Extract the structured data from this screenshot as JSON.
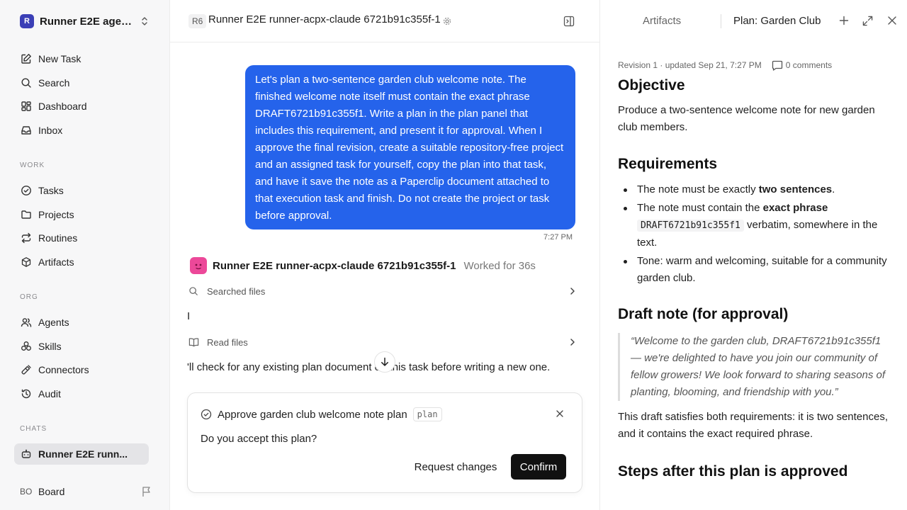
{
  "sidebar": {
    "workspace": {
      "logo": "R",
      "name": "Runner E2E agen..."
    },
    "top_items": [
      {
        "label": "New Task",
        "icon": "edit-icon"
      },
      {
        "label": "Search",
        "icon": "search-icon"
      },
      {
        "label": "Dashboard",
        "icon": "dashboard-icon"
      },
      {
        "label": "Inbox",
        "icon": "inbox-icon"
      }
    ],
    "work_label": "WORK",
    "work_items": [
      {
        "label": "Tasks",
        "icon": "check-circle-icon"
      },
      {
        "label": "Projects",
        "icon": "folder-icon"
      },
      {
        "label": "Routines",
        "icon": "repeat-icon"
      },
      {
        "label": "Artifacts",
        "icon": "cube-icon"
      }
    ],
    "org_label": "ORG",
    "org_items": [
      {
        "label": "Agents",
        "icon": "users-icon"
      },
      {
        "label": "Skills",
        "icon": "skills-icon"
      },
      {
        "label": "Connectors",
        "icon": "plug-icon"
      },
      {
        "label": "Audit",
        "icon": "history-icon"
      }
    ],
    "chats_label": "CHATS",
    "chat_item": "Runner E2E runn...",
    "user": {
      "initials": "BO",
      "name": "Board"
    }
  },
  "topbar": {
    "badge": "R6",
    "title": "Runner E2E runner-acpx-claude 6721b91c355f-1"
  },
  "chat": {
    "user_message": "Let's plan a two-sentence garden club welcome note. The finished welcome note itself must contain the exact phrase DRAFT6721b91c355f1. Write a plan in the plan panel that includes this requirement, and present it for approval. When I approve the final revision, create a suitable repository-free project and an assigned task for yourself, copy the plan into that task, and have it save the note as a Paperclip document attached to that execution task and finish. Do not create the project or task before approval.",
    "user_time": "7:27 PM",
    "agent_name": "Runner E2E runner-acpx-claude 6721b91c355f-1",
    "agent_worked": "Worked for 36s",
    "step1": "Searched files",
    "text1": "I",
    "step2": "Read files",
    "text2": "'ll check for any existing plan document on this task before writing a new one."
  },
  "approval": {
    "title": "Approve garden club welcome note plan",
    "tag": "plan",
    "question": "Do you accept this plan?",
    "request_label": "Request changes",
    "confirm_label": "Confirm"
  },
  "panel": {
    "tab_artifacts": "Artifacts",
    "tab_plan": "Plan: Garden Club",
    "revision": "Revision 1 · updated Sep 21, 7:27 PM",
    "comments": "0 comments",
    "h_objective": "Objective",
    "objective": "Produce a two-sentence welcome note for new garden club members.",
    "h_requirements": "Requirements",
    "req1_pre": "The note must be exactly ",
    "req1_bold": "two sentences",
    "req1_post": ".",
    "req2_pre": "The note must contain the ",
    "req2_bold": "exact phrase",
    "req2_code": "DRAFT6721b91c355f1",
    "req2_post": " verbatim, somewhere in the text.",
    "req3": "Tone: warm and welcoming, suitable for a community garden club.",
    "h_draft": "Draft note (for approval)",
    "draft_quote": "“Welcome to the garden club, DRAFT6721b91c355f1 — we're delighted to have you join our community of fellow growers! We look forward to sharing seasons of planting, blooming, and friendship with you.”",
    "draft_note": "This draft satisfies both requirements: it is two sentences, and it contains the exact required phrase.",
    "h_steps": "Steps after this plan is approved"
  }
}
